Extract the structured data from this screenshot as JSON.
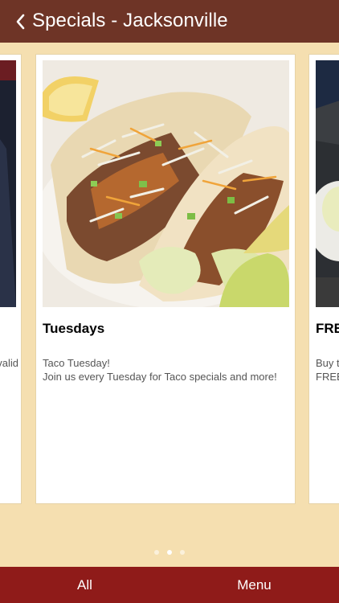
{
  "header": {
    "title": "Specials - Jacksonville",
    "back_icon": "chevron-left-icon"
  },
  "cards": {
    "left": {
      "text_lines": [
        "",
        "valid"
      ]
    },
    "center": {
      "title": "Tuesdays",
      "text_lines": [
        "Taco Tuesday!",
        "Join us every Tuesday for Taco specials and more!"
      ]
    },
    "right": {
      "title": "FRE",
      "text_lines": [
        "Buy t",
        "FREE"
      ]
    }
  },
  "pager": {
    "count": 3,
    "active_index": 1
  },
  "tabbar": {
    "items": [
      {
        "label": "All"
      },
      {
        "label": "Menu"
      }
    ]
  },
  "colors": {
    "header_bg": "#6e3426",
    "page_bg": "#f5dfb0",
    "tabbar_bg": "#8f1b19"
  }
}
